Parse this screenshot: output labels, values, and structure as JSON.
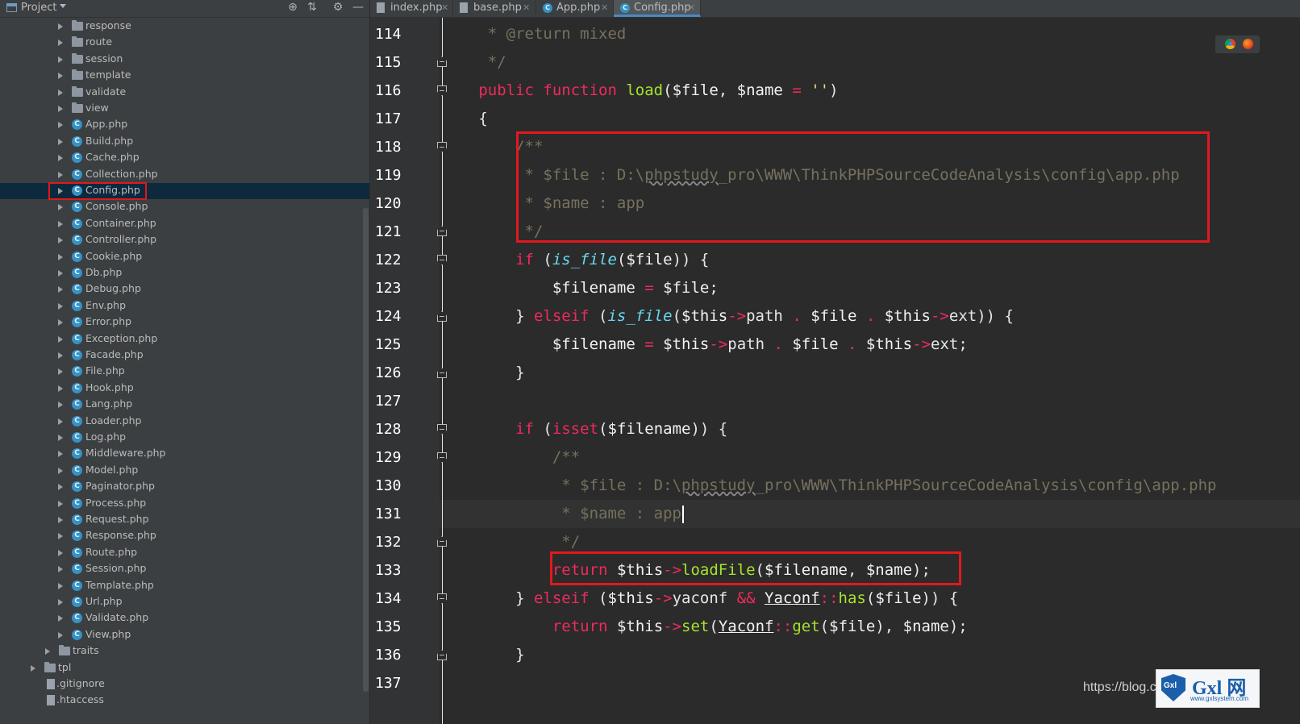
{
  "project_panel": {
    "title": "Project",
    "tree": [
      {
        "label": "response",
        "kind": "folder"
      },
      {
        "label": "route",
        "kind": "folder"
      },
      {
        "label": "session",
        "kind": "folder"
      },
      {
        "label": "template",
        "kind": "folder"
      },
      {
        "label": "validate",
        "kind": "folder"
      },
      {
        "label": "view",
        "kind": "folder"
      },
      {
        "label": "App.php",
        "kind": "class"
      },
      {
        "label": "Build.php",
        "kind": "class"
      },
      {
        "label": "Cache.php",
        "kind": "class"
      },
      {
        "label": "Collection.php",
        "kind": "class"
      },
      {
        "label": "Config.php",
        "kind": "class",
        "selected": true
      },
      {
        "label": "Console.php",
        "kind": "class"
      },
      {
        "label": "Container.php",
        "kind": "class"
      },
      {
        "label": "Controller.php",
        "kind": "class"
      },
      {
        "label": "Cookie.php",
        "kind": "class"
      },
      {
        "label": "Db.php",
        "kind": "class"
      },
      {
        "label": "Debug.php",
        "kind": "class"
      },
      {
        "label": "Env.php",
        "kind": "class"
      },
      {
        "label": "Error.php",
        "kind": "class"
      },
      {
        "label": "Exception.php",
        "kind": "class"
      },
      {
        "label": "Facade.php",
        "kind": "class"
      },
      {
        "label": "File.php",
        "kind": "class"
      },
      {
        "label": "Hook.php",
        "kind": "class"
      },
      {
        "label": "Lang.php",
        "kind": "class"
      },
      {
        "label": "Loader.php",
        "kind": "class"
      },
      {
        "label": "Log.php",
        "kind": "class"
      },
      {
        "label": "Middleware.php",
        "kind": "class"
      },
      {
        "label": "Model.php",
        "kind": "class"
      },
      {
        "label": "Paginator.php",
        "kind": "class"
      },
      {
        "label": "Process.php",
        "kind": "class"
      },
      {
        "label": "Request.php",
        "kind": "class"
      },
      {
        "label": "Response.php",
        "kind": "class"
      },
      {
        "label": "Route.php",
        "kind": "class"
      },
      {
        "label": "Session.php",
        "kind": "class"
      },
      {
        "label": "Template.php",
        "kind": "class"
      },
      {
        "label": "Url.php",
        "kind": "class"
      },
      {
        "label": "Validate.php",
        "kind": "class"
      },
      {
        "label": "View.php",
        "kind": "class"
      },
      {
        "label": "traits",
        "kind": "folder"
      },
      {
        "label": "tpl",
        "kind": "folder"
      },
      {
        "label": ".gitignore",
        "kind": "file"
      },
      {
        "label": ".htaccess",
        "kind": "file"
      }
    ]
  },
  "tabs": [
    {
      "label": "index.php",
      "icon": "php-file-icon"
    },
    {
      "label": "base.php",
      "icon": "php-file-icon"
    },
    {
      "label": "App.php",
      "icon": "class-icon"
    },
    {
      "label": "Config.php",
      "icon": "class-icon",
      "active": true
    }
  ],
  "editor": {
    "line_numbers": [
      "114",
      "115",
      "116",
      "117",
      "118",
      "119",
      "120",
      "121",
      "122",
      "123",
      "124",
      "125",
      "126",
      "127",
      "128",
      "129",
      "130",
      "131",
      "132",
      "133",
      "134",
      "135",
      "136",
      "137"
    ],
    "current_line": "131"
  },
  "colors": {
    "keyword": "#ee2b5c",
    "function": "#a6e22e",
    "comment": "#75715e",
    "highlight_box": "#e0191c",
    "selection": "#0d293e"
  },
  "watermark": {
    "url_text": "https://blog.c",
    "logo_text": "Gxl 网",
    "logo_sub": "www.gxlsystem.com",
    "shield_text": "Gxl"
  }
}
